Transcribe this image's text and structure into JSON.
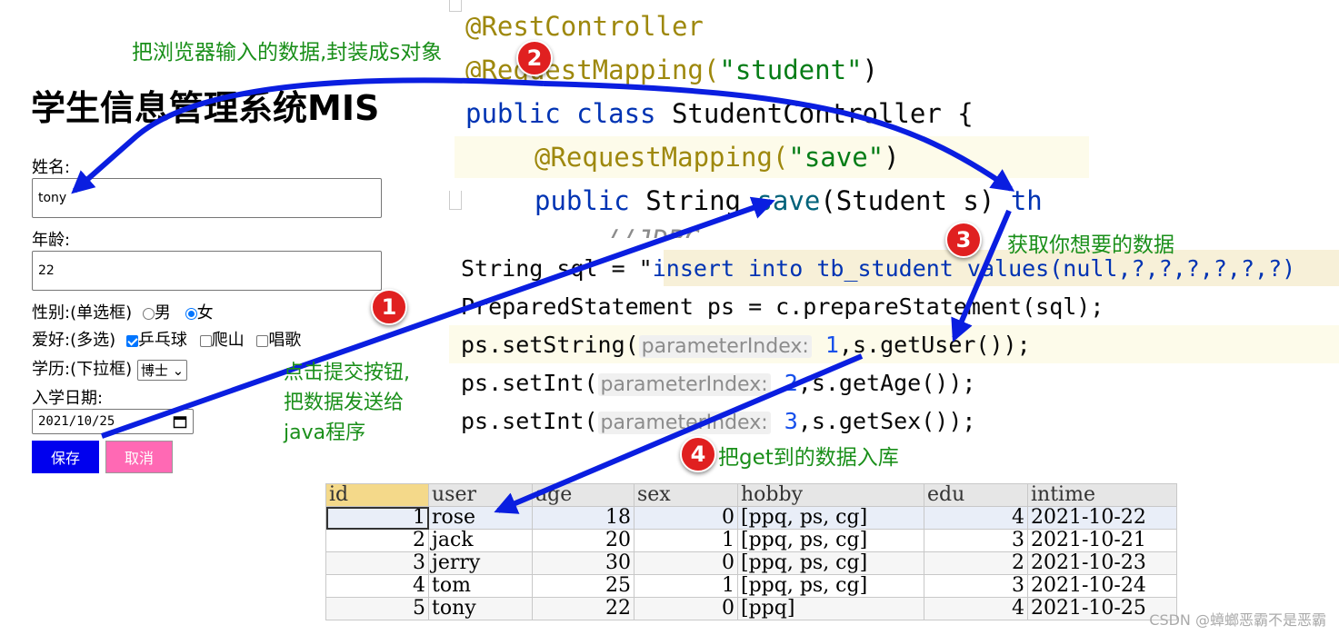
{
  "editor": {
    "line1": "@RestController",
    "line2_annotation": "@RequestMapping(",
    "line2_string": "\"student\"",
    "line2_end": ")",
    "line3_kw": "public class",
    "line3_rest": " StudentController {",
    "line4_annotation": "@RequestMapping(",
    "line4_string": "\"save\"",
    "line4_end": ")",
    "line5_kw": "public",
    "line5_type": " String ",
    "line5_fn": "save",
    "line5_params": "(Student s) ",
    "line5_kw2": "th",
    "line6_comment": "//JDBC"
  },
  "code2": {
    "sql_prefix": "String sql = \"",
    "sql_kw": "insert into",
    "sql_rest": " tb_student values(",
    "sql_null": "null",
    "sql_end": ",?,?,?,?,?,?)",
    "ps_line": "PreparedStatement ps = c.prepareStatement(sql);",
    "set1_pre": "ps.setString(",
    "set1_hint": "parameterIndex:",
    "set1_num": "1",
    "set1_post": ",s.getUser());",
    "set2_pre": "ps.setInt(",
    "set2_hint": "parameterIndex:",
    "set2_num": "2",
    "set2_post": ",s.getAge());",
    "set3_pre": "ps.setInt(",
    "set3_hint": "parameterIndex:",
    "set3_num": "3",
    "set3_post": ",s.getSex());"
  },
  "form": {
    "title": "学生信息管理系统MIS",
    "name_label": "姓名:",
    "name_value": "tony",
    "age_label": "年龄:",
    "age_value": "22",
    "sex_label": "性别:(单选框)",
    "sex_male": "男",
    "sex_female": "女",
    "hobby_label": "爱好:(多选)",
    "hobby_1": "乒乓球",
    "hobby_2": "爬山",
    "hobby_3": "唱歌",
    "edu_label": "学历:(下拉框)",
    "edu_value": "博士",
    "date_label": "入学日期:",
    "date_value": "2021/10/25",
    "save_label": "保存",
    "cancel_label": "取消",
    "save_color": "#0000ee",
    "cancel_color": "#ff69b4"
  },
  "annotations": {
    "step1_badge": "1",
    "step1_text_l1": "点击提交按钮,",
    "step1_text_l2": "把数据发送给",
    "step1_text_l3": "java程序",
    "step2_badge": "2",
    "step2_text": "把浏览器输入的数据,封装成s对象",
    "step3_badge": "3",
    "step3_text": "获取你想要的数据",
    "step4_badge": "4",
    "step4_text": "把get到的数据入库",
    "arrow_color": "#0a1ee0",
    "note_color": "#1a8f1a"
  },
  "db_table": {
    "columns": [
      "id",
      "user",
      "age",
      "sex",
      "hobby",
      "edu",
      "intime"
    ],
    "rows": [
      [
        "1",
        "rose",
        "18",
        "0",
        "[ppq, ps, cg]",
        "4",
        "2021-10-22"
      ],
      [
        "2",
        "jack",
        "20",
        "1",
        "[ppq, ps, cg]",
        "3",
        "2021-10-21"
      ],
      [
        "3",
        "jerry",
        "30",
        "0",
        "[ppq, ps, cg]",
        "2",
        "2021-10-23"
      ],
      [
        "4",
        "tom",
        "25",
        "1",
        "[ppq, ps, cg]",
        "3",
        "2021-10-24"
      ],
      [
        "5",
        "tony",
        "22",
        "0",
        "[ppq]",
        "4",
        "2021-10-25"
      ]
    ]
  },
  "watermark": "CSDN @蟑螂恶霸不是恶霸"
}
